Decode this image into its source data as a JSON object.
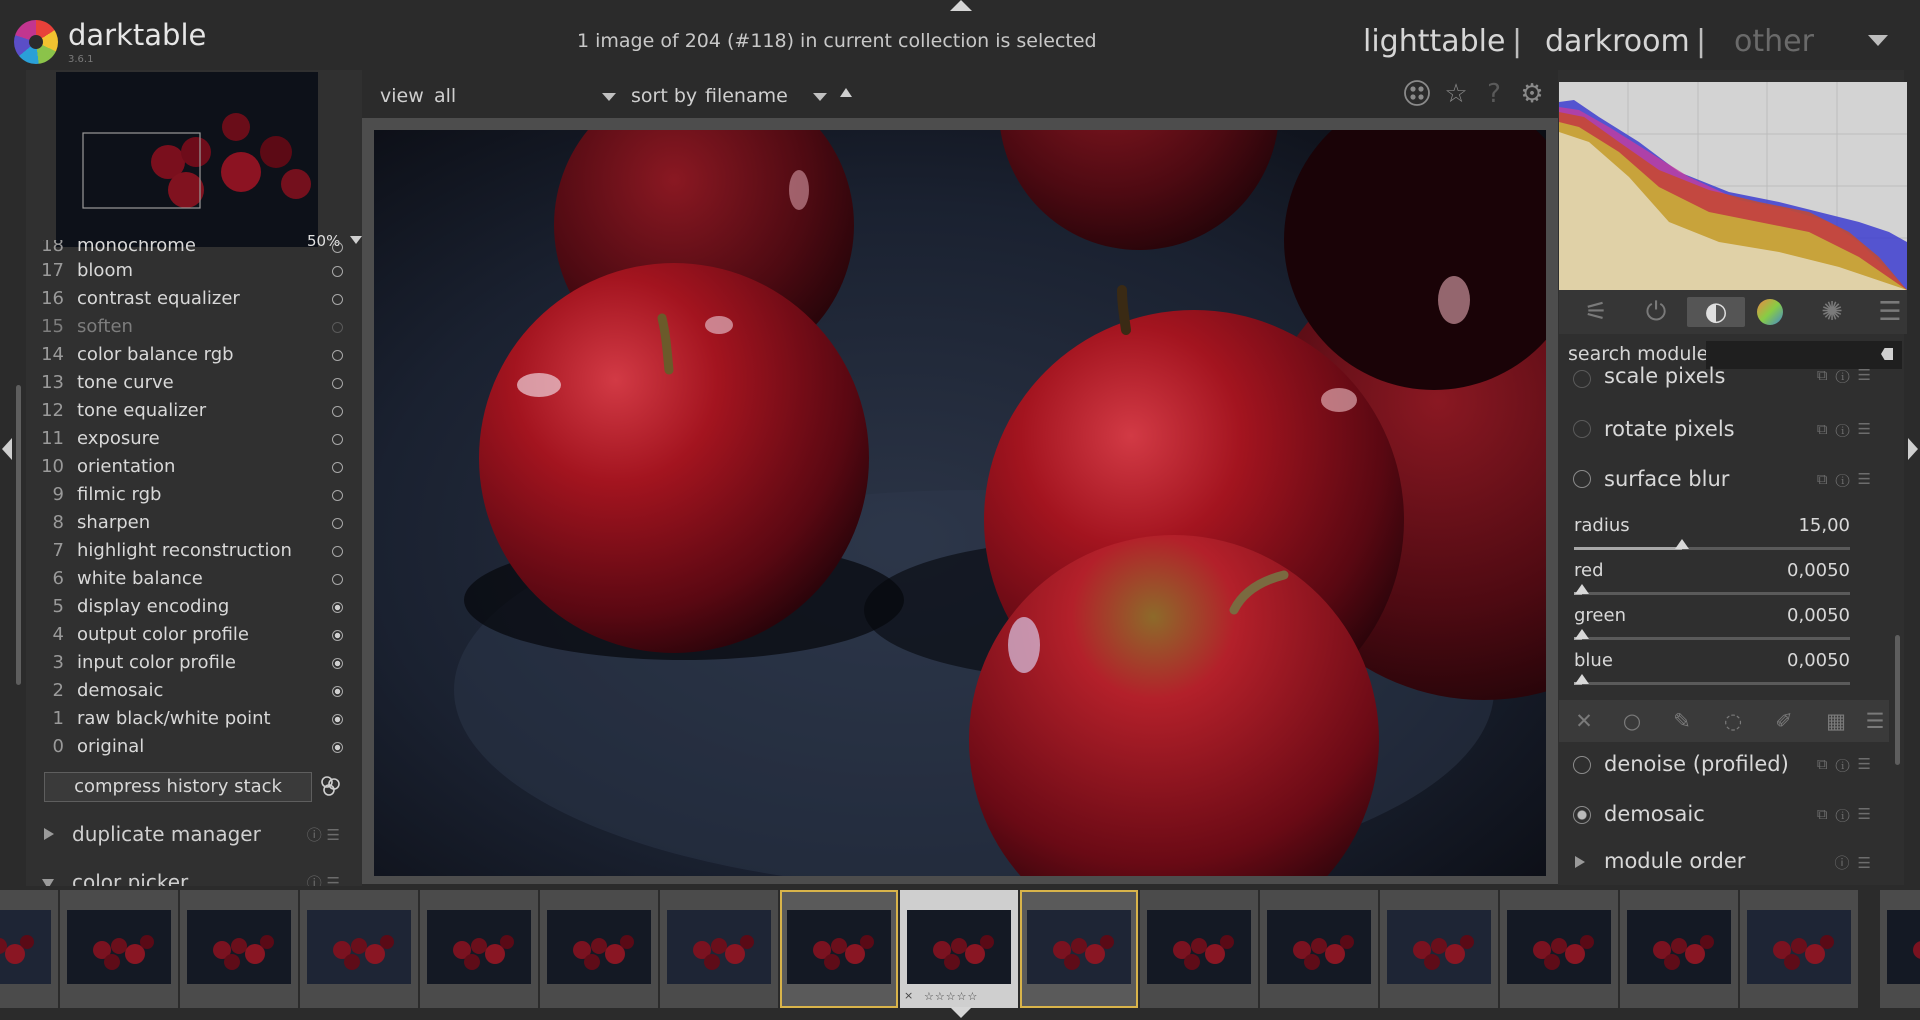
{
  "app": {
    "name": "darktable",
    "version": "3.6.1"
  },
  "status_text": "1 image of 204 (#118) in current collection is selected",
  "views": {
    "lighttable": "lighttable",
    "sep": "|",
    "darkroom": "darkroom",
    "other": "other"
  },
  "navigator": {
    "zoom": "50%"
  },
  "history": [
    {
      "num": "18",
      "label": "monochrome",
      "state": "partial"
    },
    {
      "num": "17",
      "label": "bloom",
      "state": "toggle"
    },
    {
      "num": "16",
      "label": "contrast equalizer",
      "state": "toggle"
    },
    {
      "num": "15",
      "label": "soften",
      "state": "off"
    },
    {
      "num": "14",
      "label": "color balance rgb",
      "state": "toggle"
    },
    {
      "num": "13",
      "label": "tone curve",
      "state": "toggle"
    },
    {
      "num": "12",
      "label": "tone equalizer",
      "state": "toggle"
    },
    {
      "num": "11",
      "label": "exposure",
      "state": "toggle"
    },
    {
      "num": "10",
      "label": "orientation",
      "state": "toggle"
    },
    {
      "num": "9",
      "label": "filmic rgb",
      "state": "toggle"
    },
    {
      "num": "8",
      "label": "sharpen",
      "state": "toggle"
    },
    {
      "num": "7",
      "label": "highlight reconstruction",
      "state": "toggle"
    },
    {
      "num": "6",
      "label": "white balance",
      "state": "toggle"
    },
    {
      "num": "5",
      "label": "display encoding",
      "state": "on"
    },
    {
      "num": "4",
      "label": "output color profile",
      "state": "on"
    },
    {
      "num": "3",
      "label": "input color profile",
      "state": "on"
    },
    {
      "num": "2",
      "label": "demosaic",
      "state": "on"
    },
    {
      "num": "1",
      "label": "raw black/white point",
      "state": "on"
    },
    {
      "num": "0",
      "label": "original",
      "state": "on"
    }
  ],
  "compress_history": "compress history stack",
  "left_modules": {
    "duplicate_manager": "duplicate manager",
    "color_picker": "color picker"
  },
  "toolbar": {
    "view_label": "view",
    "view_value": "all",
    "sort_label": "sort by",
    "sort_value": "filename"
  },
  "search": {
    "label": "search module",
    "value": ""
  },
  "right_modules": {
    "scale_pixels": "scale pixels",
    "rotate_pixels": "rotate pixels",
    "surface_blur": "surface blur",
    "denoise": "denoise (profiled)",
    "demosaic": "demosaic",
    "module_order": "module order"
  },
  "sliders": [
    {
      "label": "radius",
      "value": "15,00",
      "fraction": 0.39
    },
    {
      "label": "red",
      "value": "0,0050",
      "fraction": 0.03
    },
    {
      "label": "green",
      "value": "0,0050",
      "fraction": 0.03
    },
    {
      "label": "blue",
      "value": "0,0050",
      "fraction": 0.03
    }
  ],
  "filmstrip": {
    "current_stars": "☆☆☆☆☆",
    "reject": "×"
  },
  "colors": {
    "accent_selected": "#d9b44a",
    "background": "#2b2b2b",
    "panel": "#303030"
  }
}
